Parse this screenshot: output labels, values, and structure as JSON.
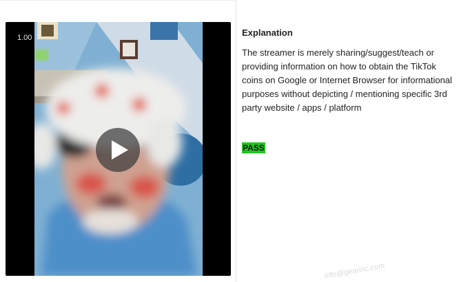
{
  "video": {
    "speed": "1.00",
    "play_icon": "play-icon"
  },
  "explanation": {
    "title": "Explanation",
    "body": "The streamer is merely sharing/suggest/teach or providing information on how to obtain the TikTok coins on Google or Internet Browser for informational purposes without depicting / mentioning specific 3rd party website / apps / platform"
  },
  "result": {
    "label": "PASS",
    "color": "#22c522"
  },
  "watermark": {
    "text": "info@gearinc.com"
  }
}
